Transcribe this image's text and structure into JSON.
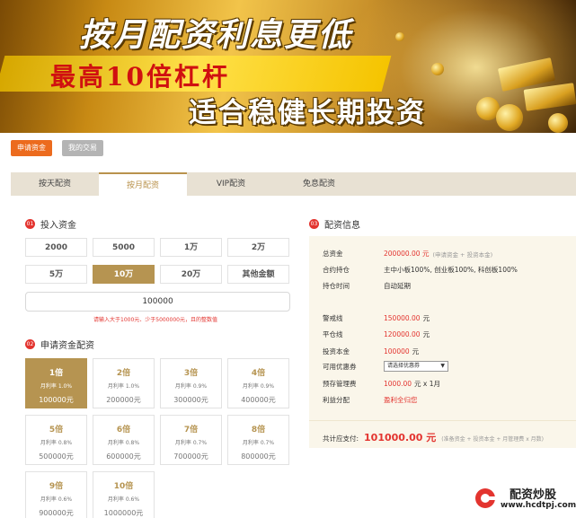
{
  "banner": {
    "line1": "按月配资利息更低",
    "line2": "最高10倍杠杆",
    "line3": "适合稳健长期投资"
  },
  "top_buttons": {
    "apply": "申请资金",
    "trades": "我的交易"
  },
  "tabs": [
    {
      "label": "按天配资",
      "active": false
    },
    {
      "label": "按月配资",
      "active": true
    },
    {
      "label": "VIP配资",
      "active": false
    },
    {
      "label": "免息配资",
      "active": false
    }
  ],
  "section1": {
    "num": "01",
    "title": "投入资金"
  },
  "amounts": [
    {
      "label": "2000",
      "active": false
    },
    {
      "label": "5000",
      "active": false
    },
    {
      "label": "1万",
      "active": false
    },
    {
      "label": "2万",
      "active": false
    },
    {
      "label": "5万",
      "active": false
    },
    {
      "label": "10万",
      "active": true
    },
    {
      "label": "20万",
      "active": false
    },
    {
      "label": "其他金额",
      "active": false
    }
  ],
  "amount_input": {
    "value": "100000"
  },
  "amount_hint": "请输入大于1000元、少于5000000元，且的整数值",
  "section2": {
    "num": "02",
    "title": "申请资金配资"
  },
  "multipliers": [
    {
      "title": "1倍",
      "rate": "月利率 1.0%",
      "amount": "100000元",
      "active": true
    },
    {
      "title": "2倍",
      "rate": "月利率 1.0%",
      "amount": "200000元",
      "active": false
    },
    {
      "title": "3倍",
      "rate": "月利率 0.9%",
      "amount": "300000元",
      "active": false
    },
    {
      "title": "4倍",
      "rate": "月利率 0.9%",
      "amount": "400000元",
      "active": false
    },
    {
      "title": "5倍",
      "rate": "月利率 0.8%",
      "amount": "500000元",
      "active": false
    },
    {
      "title": "6倍",
      "rate": "月利率 0.8%",
      "amount": "600000元",
      "active": false
    },
    {
      "title": "7倍",
      "rate": "月利率 0.7%",
      "amount": "700000元",
      "active": false
    },
    {
      "title": "8倍",
      "rate": "月利率 0.7%",
      "amount": "800000元",
      "active": false
    },
    {
      "title": "9倍",
      "rate": "月利率 0.6%",
      "amount": "900000元",
      "active": false
    },
    {
      "title": "10倍",
      "rate": "月利率 0.6%",
      "amount": "1000000元",
      "active": false
    }
  ],
  "section3": {
    "num": "03",
    "title": "配资信息"
  },
  "info": {
    "total_label": "总资金",
    "total_value": "200000.00 元",
    "total_note": "(申请资金 + 投资本金)",
    "holding_label": "合约持仓",
    "holding_value": "主中小板100%, 创业板100%, 科创板100%",
    "period_label": "持仓时间",
    "period_value": "自动延期",
    "warn_label": "警戒线",
    "warn_value": "150000.00",
    "warn_unit": "元",
    "close_label": "平仓线",
    "close_value": "120000.00",
    "close_unit": "元",
    "principal_label": "投资本金",
    "principal_value": "100000",
    "principal_unit": "元",
    "coupon_label": "可用优惠券",
    "coupon_value": "请选择优惠券",
    "fee_label": "预存管理费",
    "fee_value": "1000.00",
    "fee_unit": "元 x 1月",
    "profit_label": "利益分配",
    "profit_value": "盈利全归您"
  },
  "total_pay": {
    "label": "共计应支付:",
    "value": "101000.00 元",
    "note": "(准备资金 + 投资本金 + 月管理费 x 月数)"
  },
  "watermark": {
    "name": "配资炒股",
    "url": "www.hcdtpj.com"
  },
  "colors": {
    "gold": "#b69451",
    "orange": "#ec6b1e",
    "red": "#e3342f",
    "panel": "#faf6ea"
  }
}
